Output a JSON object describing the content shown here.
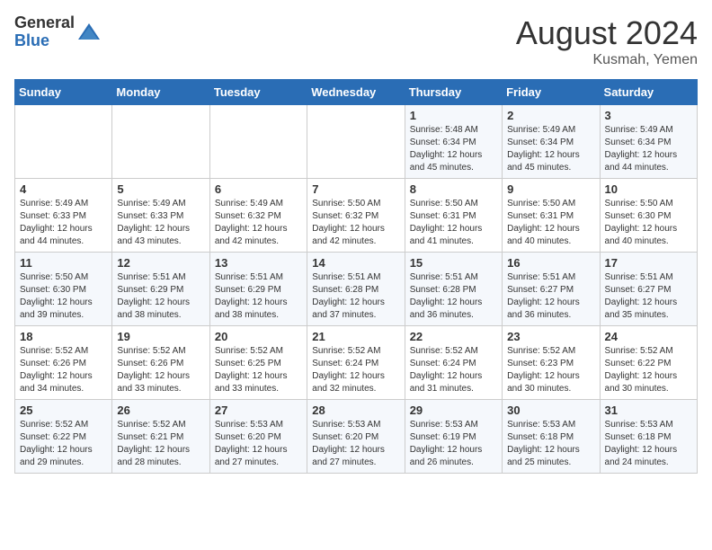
{
  "header": {
    "logo_general": "General",
    "logo_blue": "Blue",
    "month_title": "August 2024",
    "location": "Kusmah, Yemen"
  },
  "weekdays": [
    "Sunday",
    "Monday",
    "Tuesday",
    "Wednesday",
    "Thursday",
    "Friday",
    "Saturday"
  ],
  "weeks": [
    [
      {
        "day": "",
        "info": ""
      },
      {
        "day": "",
        "info": ""
      },
      {
        "day": "",
        "info": ""
      },
      {
        "day": "",
        "info": ""
      },
      {
        "day": "1",
        "info": "Sunrise: 5:48 AM\nSunset: 6:34 PM\nDaylight: 12 hours\nand 45 minutes."
      },
      {
        "day": "2",
        "info": "Sunrise: 5:49 AM\nSunset: 6:34 PM\nDaylight: 12 hours\nand 45 minutes."
      },
      {
        "day": "3",
        "info": "Sunrise: 5:49 AM\nSunset: 6:34 PM\nDaylight: 12 hours\nand 44 minutes."
      }
    ],
    [
      {
        "day": "4",
        "info": "Sunrise: 5:49 AM\nSunset: 6:33 PM\nDaylight: 12 hours\nand 44 minutes."
      },
      {
        "day": "5",
        "info": "Sunrise: 5:49 AM\nSunset: 6:33 PM\nDaylight: 12 hours\nand 43 minutes."
      },
      {
        "day": "6",
        "info": "Sunrise: 5:49 AM\nSunset: 6:32 PM\nDaylight: 12 hours\nand 42 minutes."
      },
      {
        "day": "7",
        "info": "Sunrise: 5:50 AM\nSunset: 6:32 PM\nDaylight: 12 hours\nand 42 minutes."
      },
      {
        "day": "8",
        "info": "Sunrise: 5:50 AM\nSunset: 6:31 PM\nDaylight: 12 hours\nand 41 minutes."
      },
      {
        "day": "9",
        "info": "Sunrise: 5:50 AM\nSunset: 6:31 PM\nDaylight: 12 hours\nand 40 minutes."
      },
      {
        "day": "10",
        "info": "Sunrise: 5:50 AM\nSunset: 6:30 PM\nDaylight: 12 hours\nand 40 minutes."
      }
    ],
    [
      {
        "day": "11",
        "info": "Sunrise: 5:50 AM\nSunset: 6:30 PM\nDaylight: 12 hours\nand 39 minutes."
      },
      {
        "day": "12",
        "info": "Sunrise: 5:51 AM\nSunset: 6:29 PM\nDaylight: 12 hours\nand 38 minutes."
      },
      {
        "day": "13",
        "info": "Sunrise: 5:51 AM\nSunset: 6:29 PM\nDaylight: 12 hours\nand 38 minutes."
      },
      {
        "day": "14",
        "info": "Sunrise: 5:51 AM\nSunset: 6:28 PM\nDaylight: 12 hours\nand 37 minutes."
      },
      {
        "day": "15",
        "info": "Sunrise: 5:51 AM\nSunset: 6:28 PM\nDaylight: 12 hours\nand 36 minutes."
      },
      {
        "day": "16",
        "info": "Sunrise: 5:51 AM\nSunset: 6:27 PM\nDaylight: 12 hours\nand 36 minutes."
      },
      {
        "day": "17",
        "info": "Sunrise: 5:51 AM\nSunset: 6:27 PM\nDaylight: 12 hours\nand 35 minutes."
      }
    ],
    [
      {
        "day": "18",
        "info": "Sunrise: 5:52 AM\nSunset: 6:26 PM\nDaylight: 12 hours\nand 34 minutes."
      },
      {
        "day": "19",
        "info": "Sunrise: 5:52 AM\nSunset: 6:26 PM\nDaylight: 12 hours\nand 33 minutes."
      },
      {
        "day": "20",
        "info": "Sunrise: 5:52 AM\nSunset: 6:25 PM\nDaylight: 12 hours\nand 33 minutes."
      },
      {
        "day": "21",
        "info": "Sunrise: 5:52 AM\nSunset: 6:24 PM\nDaylight: 12 hours\nand 32 minutes."
      },
      {
        "day": "22",
        "info": "Sunrise: 5:52 AM\nSunset: 6:24 PM\nDaylight: 12 hours\nand 31 minutes."
      },
      {
        "day": "23",
        "info": "Sunrise: 5:52 AM\nSunset: 6:23 PM\nDaylight: 12 hours\nand 30 minutes."
      },
      {
        "day": "24",
        "info": "Sunrise: 5:52 AM\nSunset: 6:22 PM\nDaylight: 12 hours\nand 30 minutes."
      }
    ],
    [
      {
        "day": "25",
        "info": "Sunrise: 5:52 AM\nSunset: 6:22 PM\nDaylight: 12 hours\nand 29 minutes."
      },
      {
        "day": "26",
        "info": "Sunrise: 5:52 AM\nSunset: 6:21 PM\nDaylight: 12 hours\nand 28 minutes."
      },
      {
        "day": "27",
        "info": "Sunrise: 5:53 AM\nSunset: 6:20 PM\nDaylight: 12 hours\nand 27 minutes."
      },
      {
        "day": "28",
        "info": "Sunrise: 5:53 AM\nSunset: 6:20 PM\nDaylight: 12 hours\nand 27 minutes."
      },
      {
        "day": "29",
        "info": "Sunrise: 5:53 AM\nSunset: 6:19 PM\nDaylight: 12 hours\nand 26 minutes."
      },
      {
        "day": "30",
        "info": "Sunrise: 5:53 AM\nSunset: 6:18 PM\nDaylight: 12 hours\nand 25 minutes."
      },
      {
        "day": "31",
        "info": "Sunrise: 5:53 AM\nSunset: 6:18 PM\nDaylight: 12 hours\nand 24 minutes."
      }
    ]
  ]
}
